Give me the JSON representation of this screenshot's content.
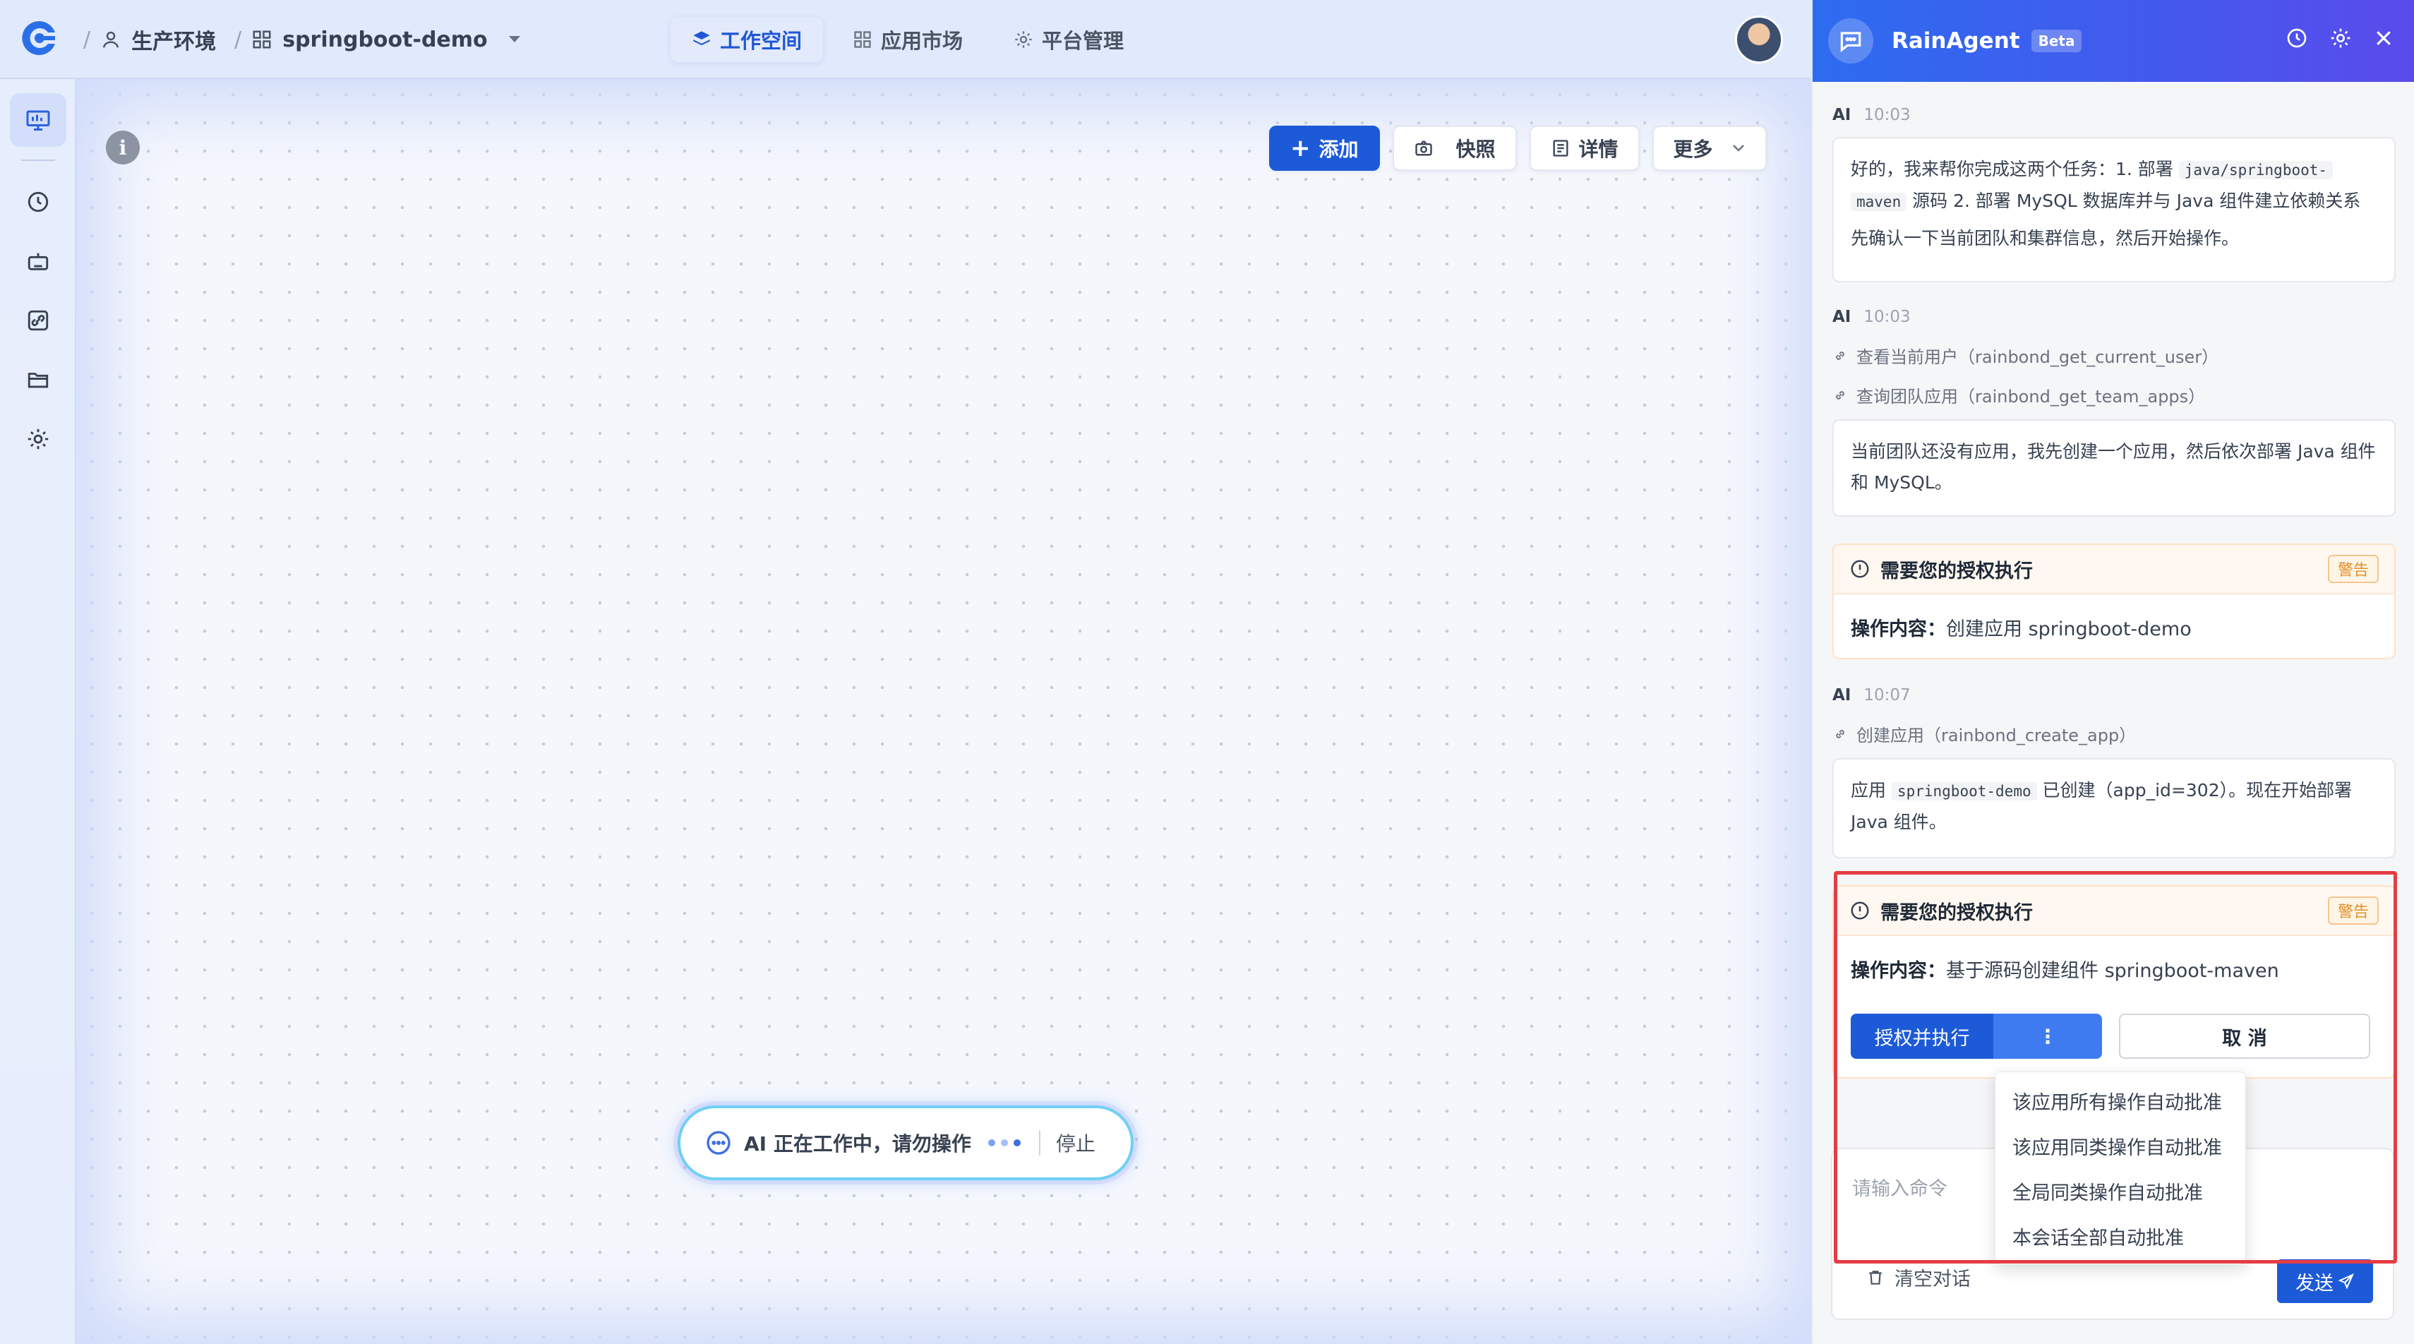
{
  "topbar": {
    "env_label": "生产环境",
    "app_label": "springboot-demo",
    "tabs": [
      {
        "label": "工作空间",
        "active": true
      },
      {
        "label": "应用市场",
        "active": false
      },
      {
        "label": "平台管理",
        "active": false
      }
    ]
  },
  "sidebar": {
    "items": [
      "monitor-icon",
      "clock-icon",
      "robot-icon",
      "link-icon",
      "folder-icon",
      "gear-icon"
    ]
  },
  "canvas": {
    "info_icon": "i",
    "toolbar": {
      "add_label": "添加",
      "snapshot_label": "快照",
      "details_label": "详情",
      "more_label": "更多"
    },
    "working": {
      "text": "AI 正在工作中，请勿操作",
      "stop_label": "停止"
    }
  },
  "agent": {
    "title": "RainAgent",
    "badge": "Beta",
    "messages": [
      {
        "who": "AI",
        "time": "10:03",
        "p1_a": "好的，我来帮你完成这两个任务：1. 部署 ",
        "p1_code": "java/springboot-",
        "p1_code2": "maven",
        "p1_b": " 源码 2. 部署 MySQL 数据库并与 Java 组件建立依赖关系",
        "p2": "先确认一下当前团队和集群信息，然后开始操作。"
      },
      {
        "who": "AI",
        "time": "10:03",
        "tools": [
          "查看当前用户（rainbond_get_current_user）",
          "查询团队应用（rainbond_get_team_apps）"
        ],
        "text": "当前团队还没有应用，我先创建一个应用，然后依次部署 Java 组件和 MySQL。"
      },
      {
        "who": "AI",
        "time": "10:07",
        "tools": [
          "创建应用（rainbond_create_app）"
        ],
        "text_a": "应用 ",
        "text_code": "springboot-demo",
        "text_b": " 已创建（app_id=302）。现在开始部署 Java 组件。"
      }
    ],
    "approvals": [
      {
        "title": "需要您的授权执行",
        "tag": "警告",
        "label": "操作内容：",
        "content": "创建应用 springboot-demo"
      },
      {
        "title": "需要您的授权执行",
        "tag": "警告",
        "label": "操作内容：",
        "content": "基于源码创建组件 springboot-maven",
        "approve_label": "授权并执行",
        "more_label": "⋮",
        "cancel_label": "取 消"
      }
    ],
    "dropdown": [
      "该应用所有操作自动批准",
      "该应用同类操作自动批准",
      "全局同类操作自动批准",
      "本会话全部自动批准"
    ],
    "input_placeholder": "请输入命令",
    "clear_label": "清空对话",
    "send_label": "发送"
  },
  "colors": {
    "accent": "#1d5ad8",
    "header_gradient_start": "#2d6cf0",
    "header_gradient_end": "#5b4bec",
    "warning": "#e0902a",
    "highlight_box": "#e43d44"
  }
}
